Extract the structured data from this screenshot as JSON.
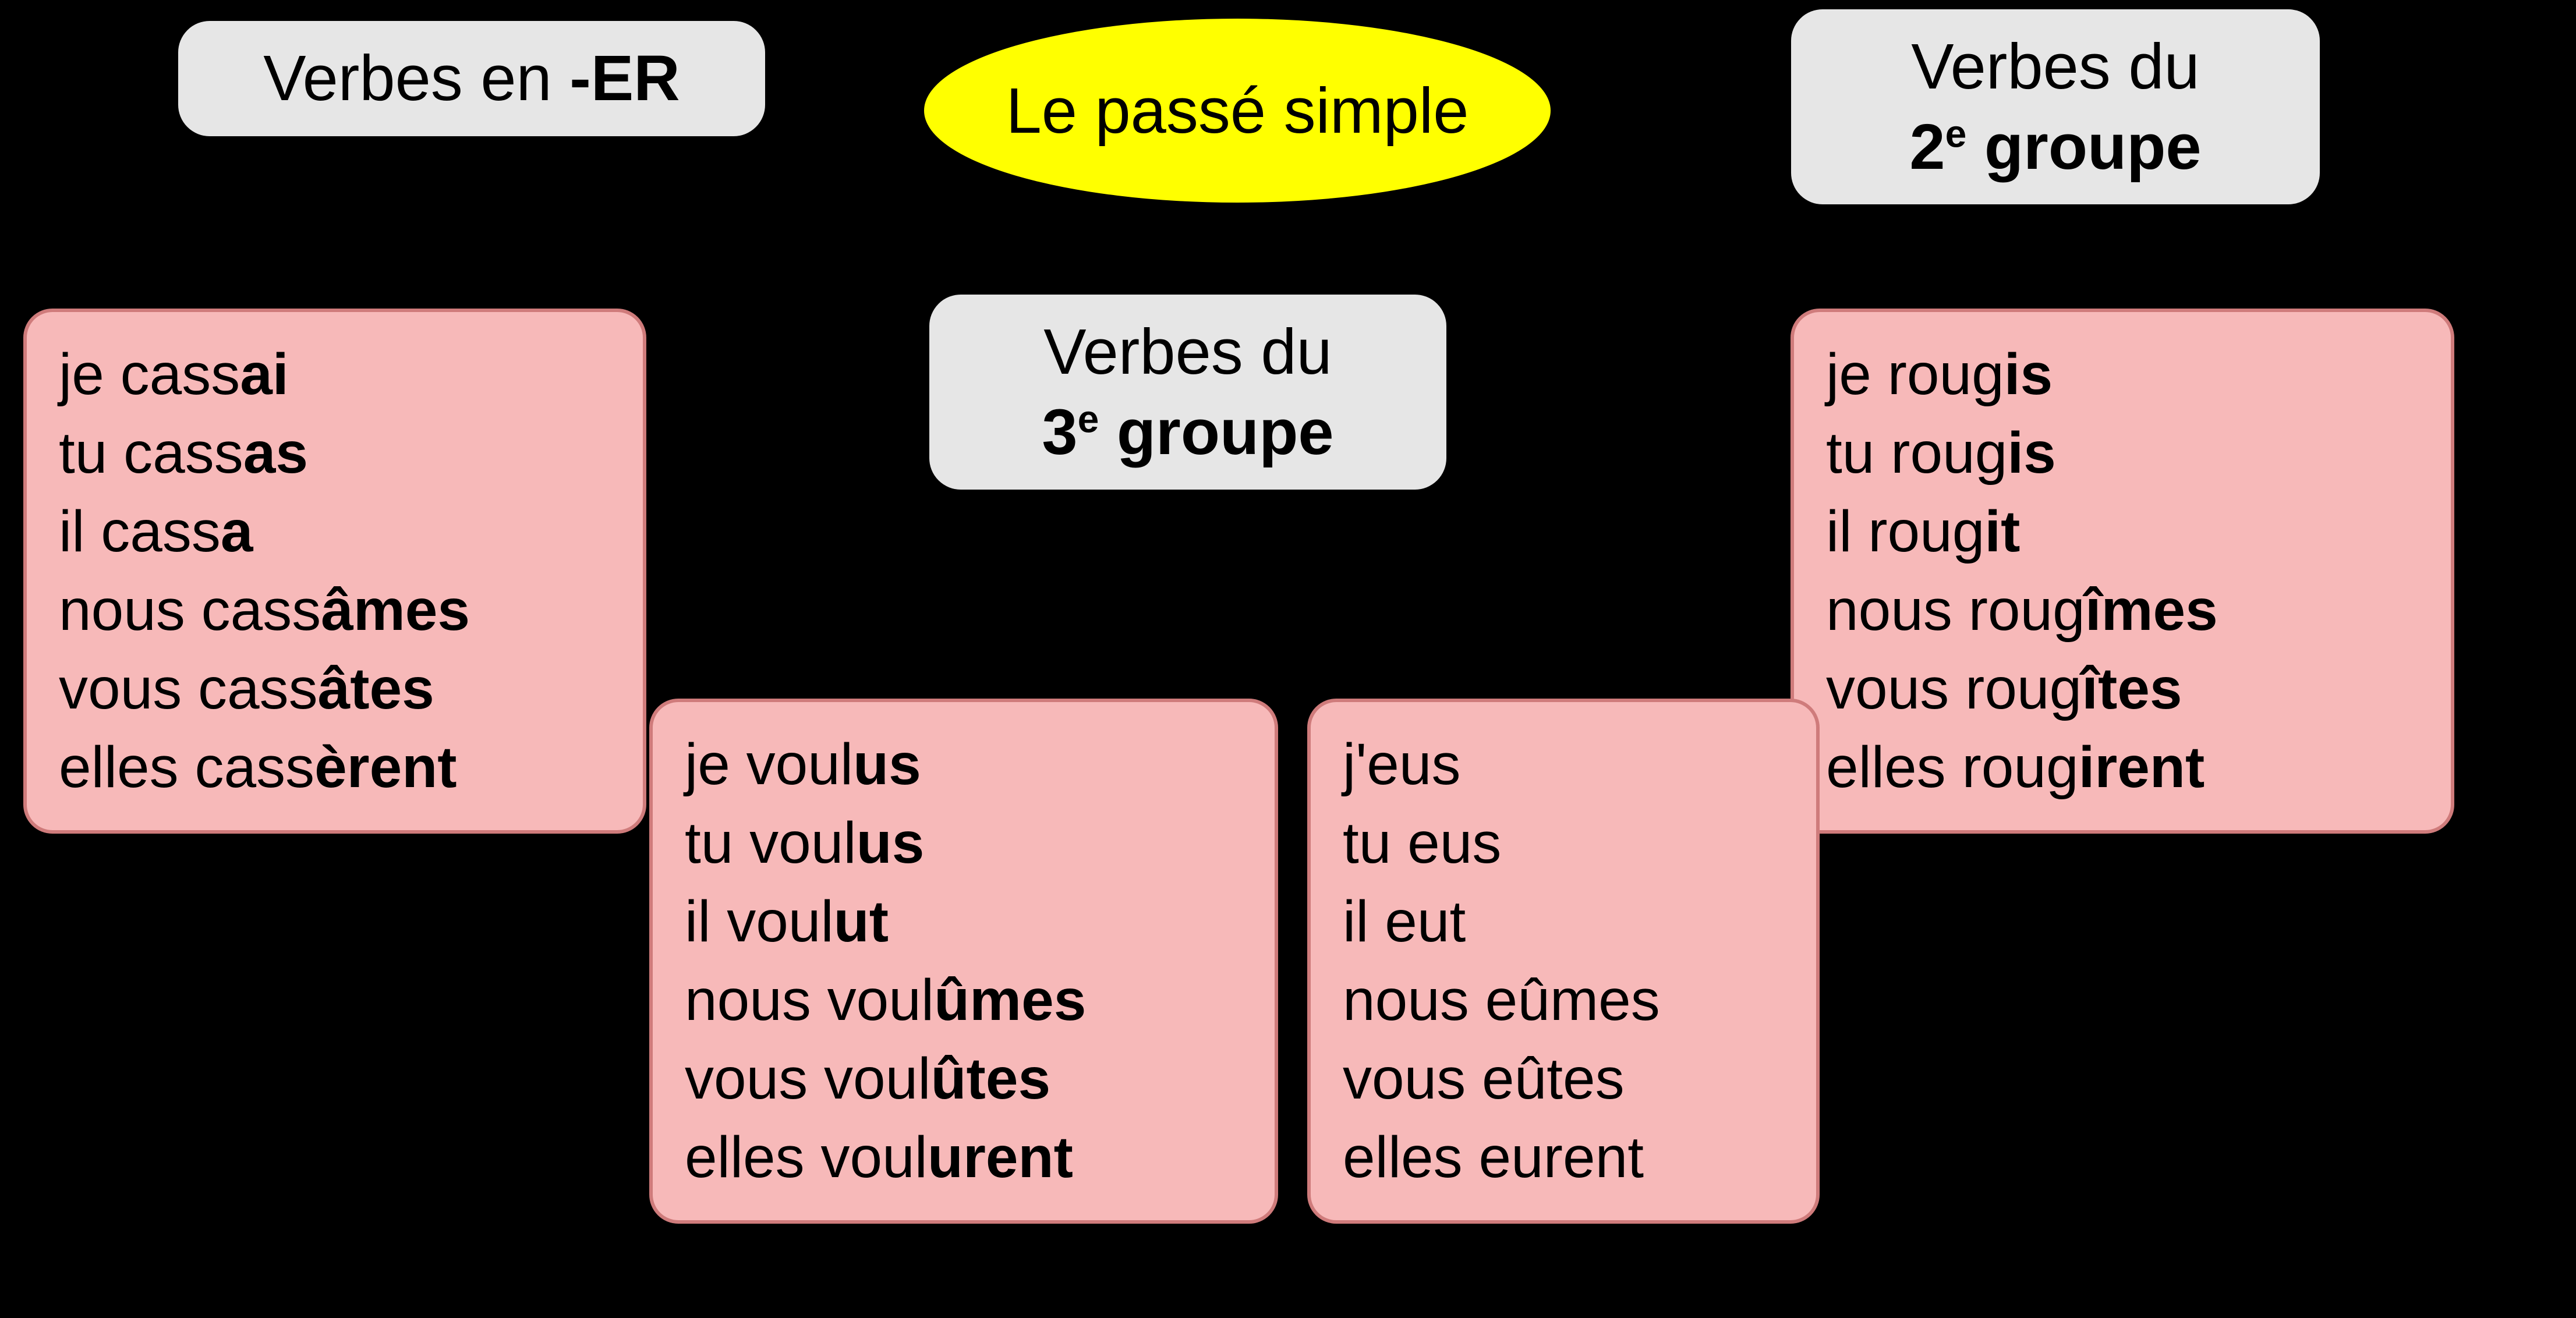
{
  "title": "Le passé simple",
  "labels": {
    "er_prefix": "Verbes en ",
    "er_bold": "-ER",
    "g2_prefix": "Verbes du",
    "g2_bold": "2<sup>e</sup> groupe",
    "g3_prefix": "Verbes du",
    "g3_bold": "3<sup>e</sup> groupe"
  },
  "conjugations": {
    "casser": [
      {
        "stem": "je cass",
        "end": "ai"
      },
      {
        "stem": "tu cass",
        "end": "as"
      },
      {
        "stem": "il cass",
        "end": "a"
      },
      {
        "stem": "nous cass",
        "end": "âmes"
      },
      {
        "stem": "vous cass",
        "end": "âtes"
      },
      {
        "stem": "elles cass",
        "end": "èrent"
      }
    ],
    "rougir": [
      {
        "stem": "je roug",
        "end": "is"
      },
      {
        "stem": "tu roug",
        "end": "is"
      },
      {
        "stem": "il roug",
        "end": "it"
      },
      {
        "stem": "nous roug",
        "end": "îmes"
      },
      {
        "stem": "vous roug",
        "end": "îtes"
      },
      {
        "stem": "elles roug",
        "end": "irent"
      }
    ],
    "vouloir": [
      {
        "stem": "je voul",
        "end": "us"
      },
      {
        "stem": "tu voul",
        "end": "us"
      },
      {
        "stem": "il voul",
        "end": "ut"
      },
      {
        "stem": "nous voul",
        "end": "ûmes"
      },
      {
        "stem": "vous voul",
        "end": "ûtes"
      },
      {
        "stem": "elles voul",
        "end": "urent"
      }
    ],
    "avoir": [
      {
        "stem": "j'eus",
        "end": ""
      },
      {
        "stem": "tu eus",
        "end": ""
      },
      {
        "stem": "il eut",
        "end": ""
      },
      {
        "stem": "nous eûmes",
        "end": ""
      },
      {
        "stem": "vous eûtes",
        "end": ""
      },
      {
        "stem": "elles eurent",
        "end": ""
      }
    ]
  }
}
